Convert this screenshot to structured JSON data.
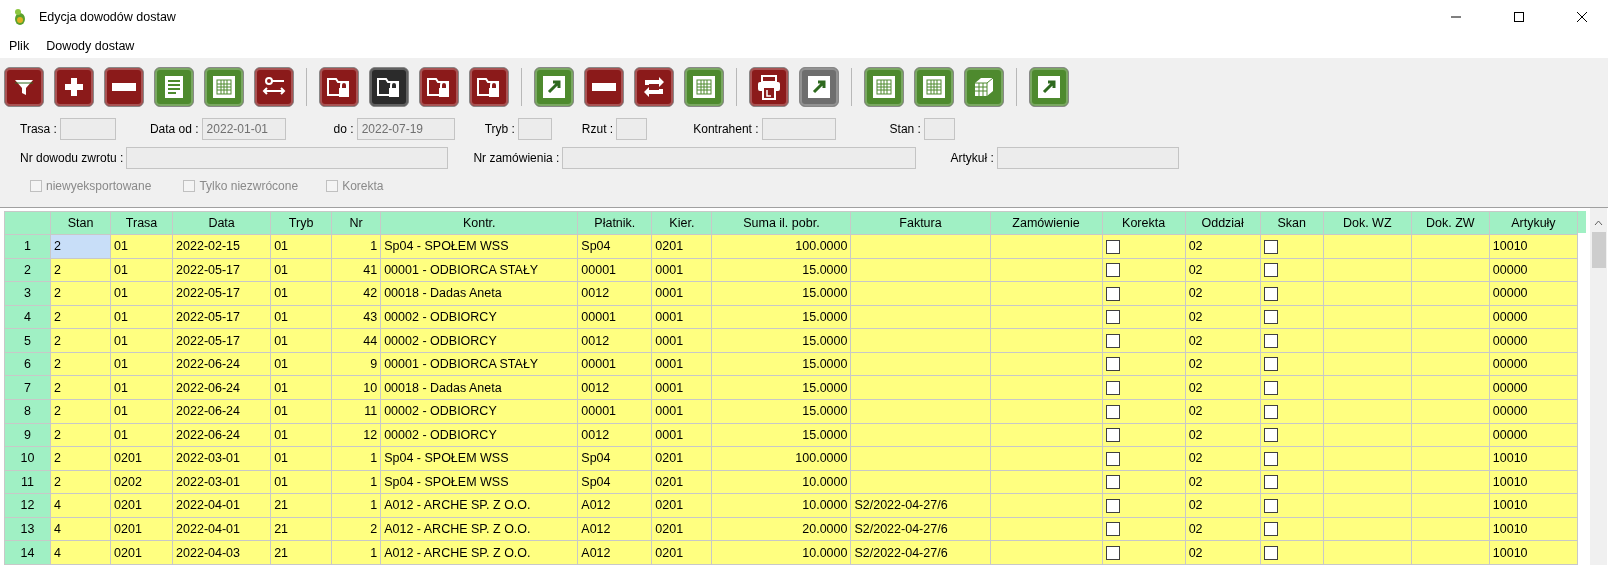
{
  "window": {
    "title": "Edycja dowodów dostaw"
  },
  "menu": [
    "Plik",
    "Dowody dostaw"
  ],
  "toolbar_groups": [
    [
      {
        "kind": "filter",
        "color": "#8b1a1a"
      },
      {
        "kind": "plus",
        "color": "#8b1a1a"
      },
      {
        "kind": "minus",
        "color": "#8b1a1a"
      },
      {
        "kind": "document",
        "color": "#4e8a2e"
      },
      {
        "kind": "table",
        "color": "#4e8a2e"
      },
      {
        "kind": "swap",
        "color": "#8b1a1a"
      }
    ],
    [
      {
        "kind": "folder-lock",
        "color": "#8b1a1a"
      },
      {
        "kind": "folder-lock",
        "color": "#2b2b2b"
      },
      {
        "kind": "folder-lock",
        "color": "#8b1a1a"
      },
      {
        "kind": "folder-lock",
        "color": "#8b1a1a"
      }
    ],
    [
      {
        "kind": "export",
        "color": "#4e8a2e"
      },
      {
        "kind": "minus",
        "color": "#8b1a1a"
      },
      {
        "kind": "refresh",
        "color": "#8b1a1a"
      },
      {
        "kind": "table",
        "color": "#4e8a2e"
      }
    ],
    [
      {
        "kind": "printer",
        "color": "#8b1a1a"
      },
      {
        "kind": "export",
        "color": "#6e6e6e"
      }
    ],
    [
      {
        "kind": "table",
        "color": "#4e8a2e"
      },
      {
        "kind": "table",
        "color": "#4e8a2e"
      },
      {
        "kind": "cube",
        "color": "#4e8a2e"
      }
    ],
    [
      {
        "kind": "export",
        "color": "#4e8a2e"
      }
    ]
  ],
  "filters": {
    "row_1": [
      {
        "label": "Trasa :"
      },
      {
        "label": "Data od :",
        "value": "2022-01-01"
      },
      {
        "label": "do :",
        "value": "2022-07-19"
      },
      {
        "label": "Tryb :"
      },
      {
        "label": "Rzut :"
      },
      {
        "label": "Kontrahent :"
      },
      {
        "label": "Stan :"
      }
    ],
    "row_2": [
      {
        "label": "Nr dowodu zwrotu :"
      },
      {
        "label": "Nr zamówienia :"
      },
      {
        "label": "Artykuł :"
      }
    ],
    "checkboxes": [
      {
        "label": "niewyeksportowane",
        "checked": false
      },
      {
        "label": "Tylko niezwrócone",
        "checked": false
      },
      {
        "label": "Korekta",
        "checked": false
      }
    ]
  },
  "table": {
    "columns": [
      {
        "label": "Stan",
        "kind": "text"
      },
      {
        "label": "Trasa",
        "kind": "text"
      },
      {
        "label": "Data",
        "kind": "text"
      },
      {
        "label": "Tryb",
        "kind": "text"
      },
      {
        "label": "Nr",
        "kind": "number"
      },
      {
        "label": "Kontr.",
        "kind": "text"
      },
      {
        "label": "Płatnik.",
        "kind": "text"
      },
      {
        "label": "Kier.",
        "kind": "text"
      },
      {
        "label": "Suma il. pobr.",
        "kind": "number"
      },
      {
        "label": "Faktura",
        "kind": "text"
      },
      {
        "label": "Zamówienie",
        "kind": "text"
      },
      {
        "label": "Korekta",
        "kind": "check"
      },
      {
        "label": "Oddział",
        "kind": "text"
      },
      {
        "label": "Skan",
        "kind": "check"
      },
      {
        "label": "Dok. WZ",
        "kind": "text"
      },
      {
        "label": "Dok. ZW",
        "kind": "text"
      },
      {
        "label": "Artykuły",
        "kind": "text"
      }
    ],
    "rows": [
      {
        "num": "1",
        "selected": true,
        "cells": [
          "2",
          "01",
          "2022-02-15",
          "01",
          "1",
          "Sp04 - SPOŁEM  WSS",
          "Sp04",
          "0201",
          "100.0000",
          null,
          null,
          false,
          "02",
          false,
          null,
          null,
          "10010"
        ]
      },
      {
        "num": "2",
        "selected": false,
        "cells": [
          "2",
          "01",
          "2022-05-17",
          "01",
          "41",
          "00001 - ODBIORCA STAŁY",
          "00001",
          "0001",
          "15.0000",
          null,
          null,
          false,
          "02",
          false,
          null,
          null,
          "00000"
        ]
      },
      {
        "num": "3",
        "selected": false,
        "cells": [
          "2",
          "01",
          "2022-05-17",
          "01",
          "42",
          "00018 - Dadas Aneta",
          "0012",
          "0001",
          "15.0000",
          null,
          null,
          false,
          "02",
          false,
          null,
          null,
          "00000"
        ]
      },
      {
        "num": "4",
        "selected": false,
        "cells": [
          "2",
          "01",
          "2022-05-17",
          "01",
          "43",
          "00002 - ODBIORCY",
          "00001",
          "0001",
          "15.0000",
          null,
          null,
          false,
          "02",
          false,
          null,
          null,
          "00000"
        ]
      },
      {
        "num": "5",
        "selected": false,
        "cells": [
          "2",
          "01",
          "2022-05-17",
          "01",
          "44",
          "00002 - ODBIORCY",
          "0012",
          "0001",
          "15.0000",
          null,
          null,
          false,
          "02",
          false,
          null,
          null,
          "00000"
        ]
      },
      {
        "num": "6",
        "selected": false,
        "cells": [
          "2",
          "01",
          "2022-06-24",
          "01",
          "9",
          "00001 - ODBIORCA STAŁY",
          "00001",
          "0001",
          "15.0000",
          null,
          null,
          false,
          "02",
          false,
          null,
          null,
          "00000"
        ]
      },
      {
        "num": "7",
        "selected": false,
        "cells": [
          "2",
          "01",
          "2022-06-24",
          "01",
          "10",
          "00018 - Dadas Aneta",
          "0012",
          "0001",
          "15.0000",
          null,
          null,
          false,
          "02",
          false,
          null,
          null,
          "00000"
        ]
      },
      {
        "num": "8",
        "selected": false,
        "cells": [
          "2",
          "01",
          "2022-06-24",
          "01",
          "11",
          "00002 - ODBIORCY",
          "00001",
          "0001",
          "15.0000",
          null,
          null,
          false,
          "02",
          false,
          null,
          null,
          "00000"
        ]
      },
      {
        "num": "9",
        "selected": false,
        "cells": [
          "2",
          "01",
          "2022-06-24",
          "01",
          "12",
          "00002 - ODBIORCY",
          "0012",
          "0001",
          "15.0000",
          null,
          null,
          false,
          "02",
          false,
          null,
          null,
          "00000"
        ]
      },
      {
        "num": "10",
        "selected": false,
        "cells": [
          "2",
          "0201",
          "2022-03-01",
          "01",
          "1",
          "Sp04 - SPOŁEM  WSS",
          "Sp04",
          "0201",
          "100.0000",
          null,
          null,
          false,
          "02",
          false,
          null,
          null,
          "10010"
        ]
      },
      {
        "num": "11",
        "selected": false,
        "cells": [
          "2",
          "0202",
          "2022-03-01",
          "01",
          "1",
          "Sp04 - SPOŁEM  WSS",
          "Sp04",
          "0201",
          "10.0000",
          null,
          null,
          false,
          "02",
          false,
          null,
          null,
          "10010"
        ]
      },
      {
        "num": "12",
        "selected": false,
        "cells": [
          "4",
          "0201",
          "2022-04-01",
          "21",
          "1",
          "A012 - ARCHE SP. Z O.O.",
          "A012",
          "0201",
          "10.0000",
          "S2/2022-04-27/6",
          null,
          false,
          "02",
          false,
          null,
          null,
          "10010"
        ]
      },
      {
        "num": "13",
        "selected": false,
        "cells": [
          "4",
          "0201",
          "2022-04-01",
          "21",
          "2",
          "A012 - ARCHE SP. Z O.O.",
          "A012",
          "0201",
          "20.0000",
          "S2/2022-04-27/6",
          null,
          false,
          "02",
          false,
          null,
          null,
          "10010"
        ]
      },
      {
        "num": "14",
        "selected": false,
        "cells": [
          "4",
          "0201",
          "2022-04-03",
          "21",
          "1",
          "A012 - ARCHE SP. Z O.O.",
          "A012",
          "0201",
          "10.0000",
          "S2/2022-04-27/6",
          null,
          false,
          "02",
          false,
          null,
          null,
          "10010"
        ]
      }
    ]
  }
}
